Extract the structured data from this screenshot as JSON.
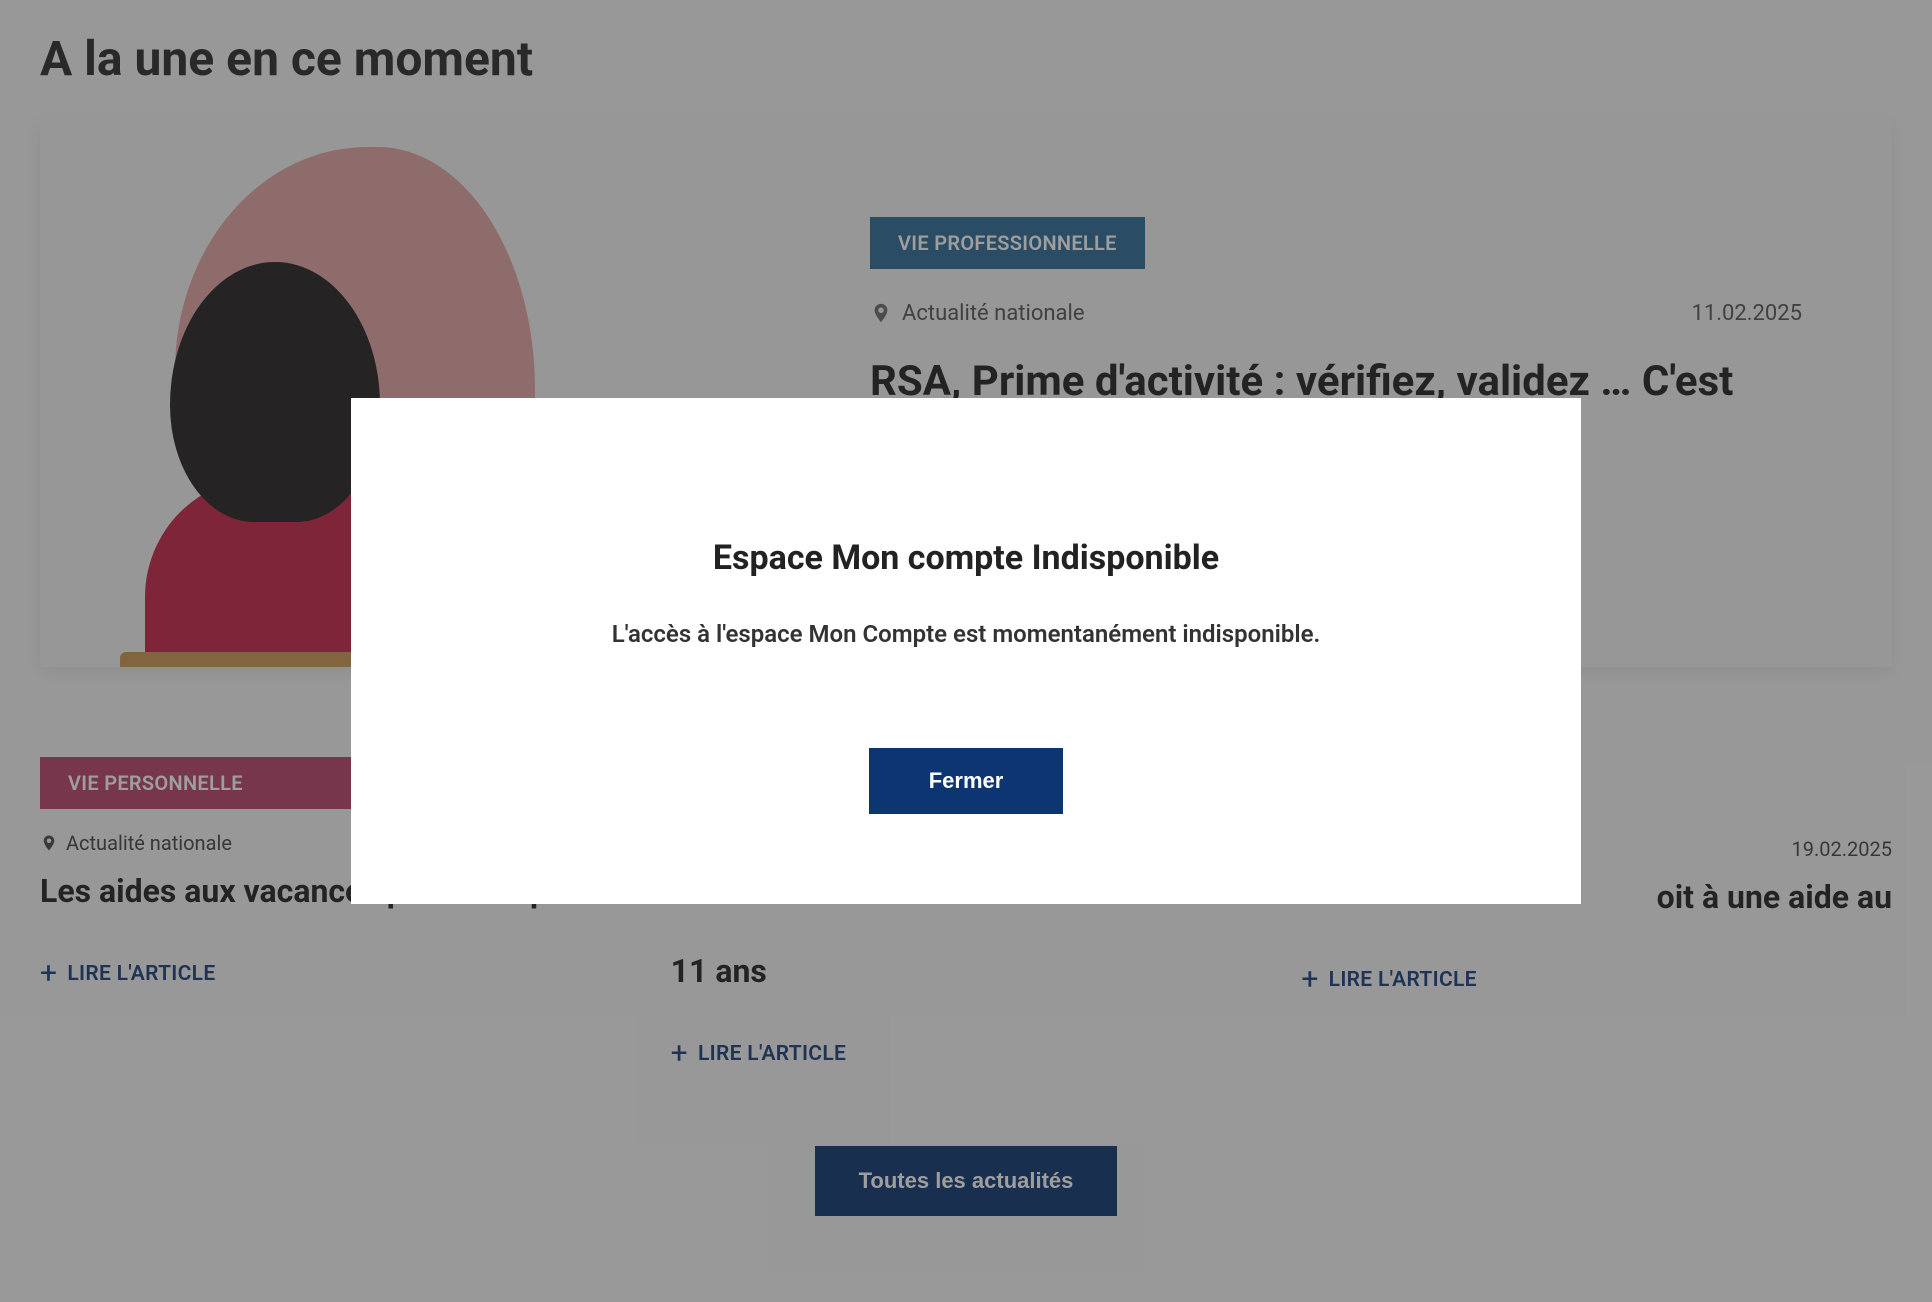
{
  "section_title": "A la une en ce moment",
  "hero": {
    "tag": "VIE PROFESSIONNELLE",
    "scope": "Actualité nationale",
    "date": "11.02.2025",
    "title": "RSA, Prime d'activité : vérifiez, validez … C'est déclaré !"
  },
  "cards": [
    {
      "tag": "VIE PERSONNELLE",
      "tag_class": "pink",
      "scope": "Actualité nationale",
      "date": "",
      "title": "Les aides aux vacances pour bien parti !",
      "read": "LIRE L'ARTICLE"
    },
    {
      "tag": "",
      "tag_class": "",
      "scope": "",
      "date": "",
      "title": "11 ans",
      "read": "LIRE L'ARTICLE"
    },
    {
      "tag": "",
      "tag_class": "",
      "scope": "",
      "date": "19.02.2025",
      "title": "oit à une aide au",
      "read": "LIRE L'ARTICLE"
    }
  ],
  "all_news_button": "Toutes les actualités",
  "modal": {
    "title": "Espace Mon compte Indisponible",
    "text": "L'accès à l'espace Mon Compte est momentanément indisponible.",
    "close": "Fermer"
  }
}
